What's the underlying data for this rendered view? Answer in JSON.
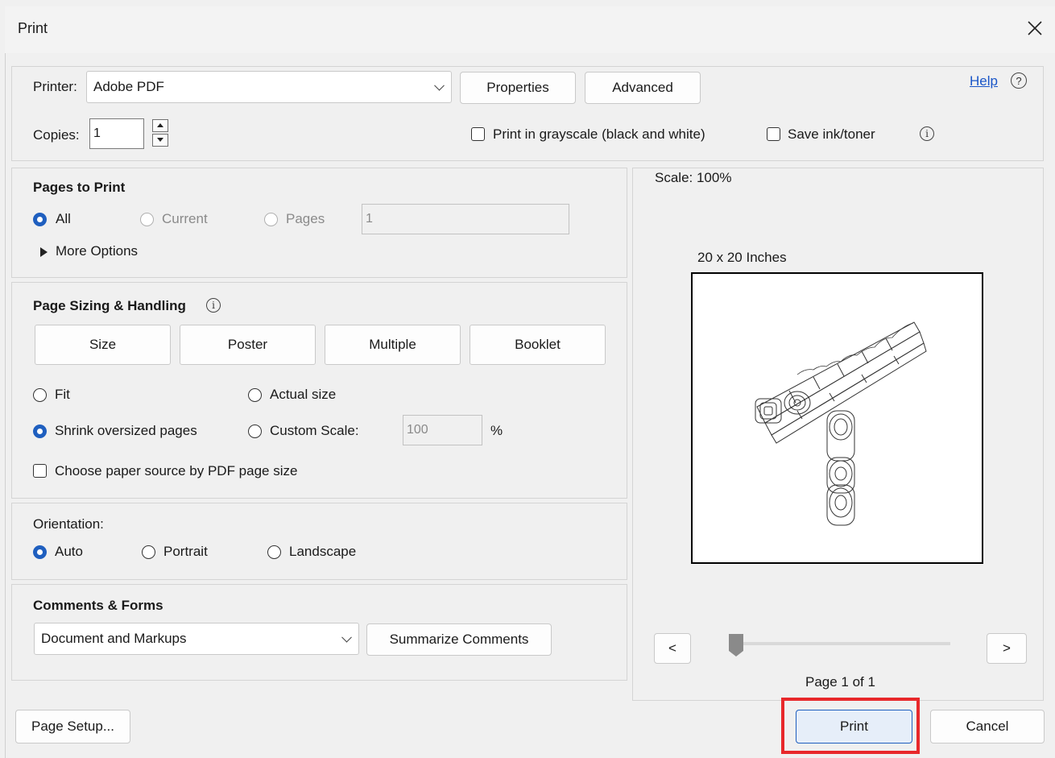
{
  "window": {
    "title": "Print"
  },
  "printer": {
    "label": "Printer:",
    "selected": "Adobe PDF",
    "properties_label": "Properties",
    "advanced_label": "Advanced",
    "help_label": "Help"
  },
  "copies": {
    "label": "Copies:",
    "value": "1"
  },
  "options": {
    "grayscale_label": "Print in grayscale (black and white)",
    "save_ink_label": "Save ink/toner"
  },
  "pages_to_print": {
    "title": "Pages to Print",
    "all_label": "All",
    "current_label": "Current",
    "pages_label": "Pages",
    "pages_value": "1",
    "more_options_label": "More Options"
  },
  "sizing": {
    "title": "Page Sizing & Handling",
    "size_label": "Size",
    "poster_label": "Poster",
    "multiple_label": "Multiple",
    "booklet_label": "Booklet",
    "fit_label": "Fit",
    "actual_size_label": "Actual size",
    "shrink_label": "Shrink oversized pages",
    "custom_scale_label": "Custom Scale:",
    "custom_scale_value": "100",
    "percent": "%",
    "paper_source_label": "Choose paper source by PDF page size"
  },
  "orientation": {
    "title": "Orientation:",
    "auto_label": "Auto",
    "portrait_label": "Portrait",
    "landscape_label": "Landscape"
  },
  "comments": {
    "title": "Comments & Forms",
    "selected": "Document and Markups",
    "summarize_label": "Summarize Comments"
  },
  "preview": {
    "scale_text": "Scale: 100%",
    "size_text": "20 x 20 Inches",
    "prev_label": "<",
    "next_label": ">",
    "page_text": "Page 1 of 1"
  },
  "footer": {
    "page_setup_label": "Page Setup...",
    "print_label": "Print",
    "cancel_label": "Cancel"
  },
  "colors": {
    "accent": "#1f5fbf",
    "highlight": "#e8282b",
    "link": "#1a56c8"
  }
}
